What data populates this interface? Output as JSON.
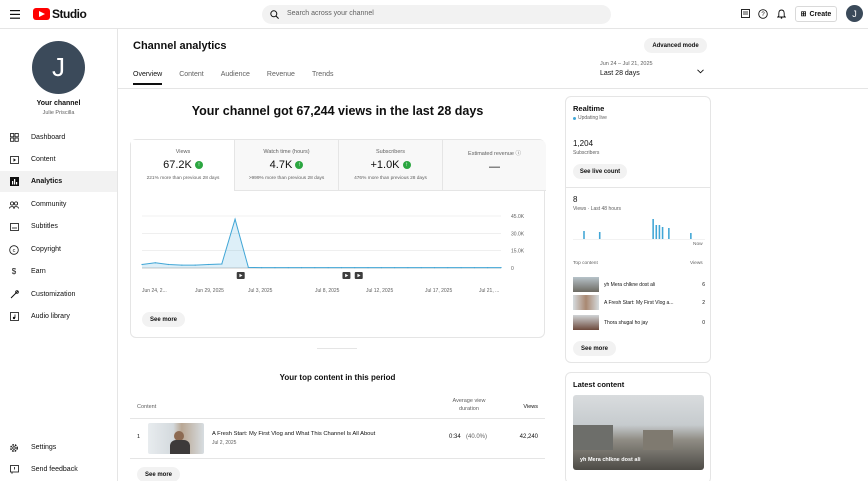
{
  "header": {
    "app_name": "Studio",
    "search_placeholder": "Search across your channel",
    "create_label": "Create",
    "avatar_letter": "J"
  },
  "sidebar": {
    "avatar_letter": "J",
    "channel_label": "Your channel",
    "channel_name": "Julie Priscilla",
    "items": [
      {
        "label": "Dashboard",
        "icon": "dashboard-icon"
      },
      {
        "label": "Content",
        "icon": "content-icon"
      },
      {
        "label": "Analytics",
        "icon": "analytics-icon"
      },
      {
        "label": "Community",
        "icon": "community-icon"
      },
      {
        "label": "Subtitles",
        "icon": "subtitles-icon"
      },
      {
        "label": "Copyright",
        "icon": "copyright-icon"
      },
      {
        "label": "Earn",
        "icon": "earn-icon"
      },
      {
        "label": "Customization",
        "icon": "customization-icon"
      },
      {
        "label": "Audio library",
        "icon": "audio-library-icon"
      }
    ],
    "settings_label": "Settings",
    "feedback_label": "Send feedback"
  },
  "main": {
    "title": "Channel analytics",
    "tabs": [
      "Overview",
      "Content",
      "Audience",
      "Revenue",
      "Trends"
    ],
    "advanced_mode_label": "Advanced mode",
    "date_range": "Jun 24 – Jul 21, 2025",
    "date_period": "Last 28 days",
    "headline": "Your channel got 67,244 views in the last 28 days",
    "metrics": [
      {
        "label": "Views",
        "value": "67.2K",
        "sub": "221% more than previous 28 days"
      },
      {
        "label": "Watch time (hours)",
        "value": "4.7K",
        "sub": ">999% more than previous 28 days"
      },
      {
        "label": "Subscribers",
        "value": "+1.0K",
        "sub": "476% more than previous 28 days"
      },
      {
        "label": "Estimated revenue",
        "value": "—",
        "sub": ""
      }
    ],
    "see_more_label": "See more",
    "top_content_title": "Your top content in this period",
    "table_headers": {
      "content": "Content",
      "avg_duration": "Average view duration",
      "views": "Views"
    },
    "top_rows": [
      {
        "rank": "1",
        "title": "A Fresh Start: My First Vlog and What This Channel Is All About",
        "date": "Jul 2, 2025",
        "duration": "0:34",
        "pct": "(40.0%)",
        "views": "42,240"
      }
    ],
    "see_more_label_2": "See more"
  },
  "chart_data": {
    "type": "line",
    "x_tick_labels": [
      "Jun 24, 2...",
      "Jun 29, 2025",
      "Jul 3, 2025",
      "Jul 8, 2025",
      "Jul 12, 2025",
      "Jul 17, 2025",
      "Jul 21, ..."
    ],
    "y_tick_labels": [
      "45.0K",
      "30.0K",
      "15.0K",
      "0"
    ],
    "ylim": [
      0,
      45000
    ],
    "x": [
      0,
      1,
      2,
      3,
      4,
      5,
      6,
      7,
      8,
      9,
      10,
      11,
      12,
      13,
      14,
      15,
      16,
      17,
      18,
      19,
      20,
      21,
      22,
      23,
      24,
      25,
      26,
      27
    ],
    "values": [
      3000,
      4500,
      3000,
      2500,
      2500,
      3000,
      3500,
      42240,
      500,
      300,
      300,
      300,
      300,
      300,
      300,
      300,
      300,
      300,
      300,
      300,
      300,
      300,
      300,
      300,
      300,
      300,
      300,
      300
    ],
    "grid": true,
    "color": "#41a6d6"
  },
  "realtime": {
    "title": "Realtime",
    "status": "Updating live",
    "subs_value": "1,204",
    "subs_label": "Subscribers",
    "see_live_label": "See live count",
    "views_value": "8",
    "views_label": "Views · Last 48 hours",
    "now_label": "Now",
    "top_content_label": "Top content",
    "views_col_label": "Views",
    "bars": [
      0,
      0,
      0,
      0.4,
      0,
      0,
      0,
      0,
      0.35,
      0,
      0,
      0,
      0,
      0,
      0,
      0,
      0,
      0,
      0,
      0,
      0,
      0,
      0,
      0,
      0,
      1,
      0.7,
      0.7,
      0.6,
      0,
      0.55,
      0,
      0,
      0,
      0,
      0,
      0,
      0.3,
      0,
      0,
      0,
      0
    ],
    "items": [
      {
        "title": "yh Mera chlkne dost ali",
        "views": "6"
      },
      {
        "title": "A Fresh Start: My First Vlog a...",
        "views": "2"
      },
      {
        "title": "Thora shugal ho jay",
        "views": "0"
      }
    ],
    "see_more_label": "See more"
  },
  "latest": {
    "title": "Latest content",
    "video_title": "yh Mera chlkne dost ali"
  },
  "colors": {
    "brand": "#ff0000",
    "accent": "#41a6d6",
    "positive": "#2ba640"
  }
}
